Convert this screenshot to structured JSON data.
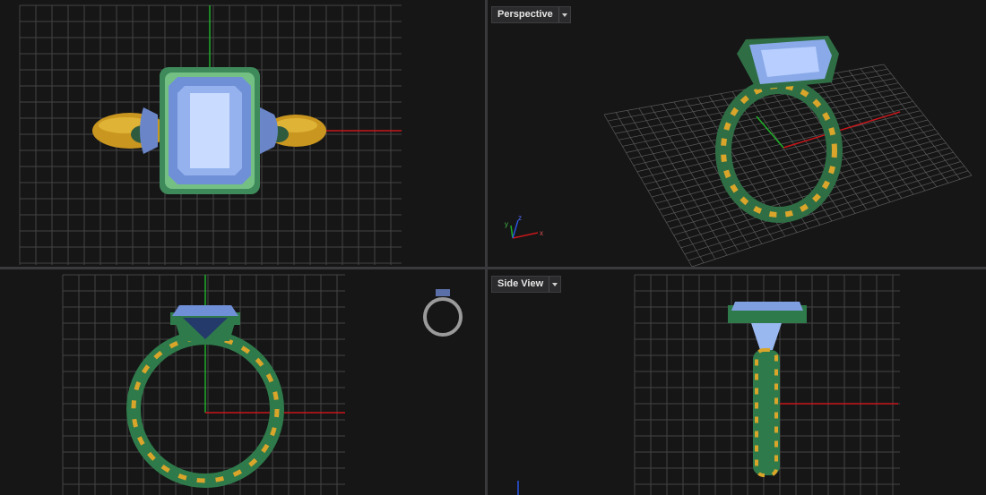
{
  "viewports": {
    "top": {
      "title": ""
    },
    "perspective": {
      "title": "Perspective"
    },
    "front": {
      "title": ""
    },
    "side": {
      "title": "Side View"
    }
  },
  "axes": {
    "x": "x",
    "y": "y",
    "z": "z"
  },
  "colors": {
    "background": "#161617",
    "grid": "#4a4a4a",
    "grid_major": "#6a6a6a",
    "x_axis": "#c8161a",
    "y_axis": "#1fae28",
    "ring_green": "#2f7a4a",
    "ring_gold": "#d9a52a",
    "gem_blue": "#9ab8f0"
  }
}
